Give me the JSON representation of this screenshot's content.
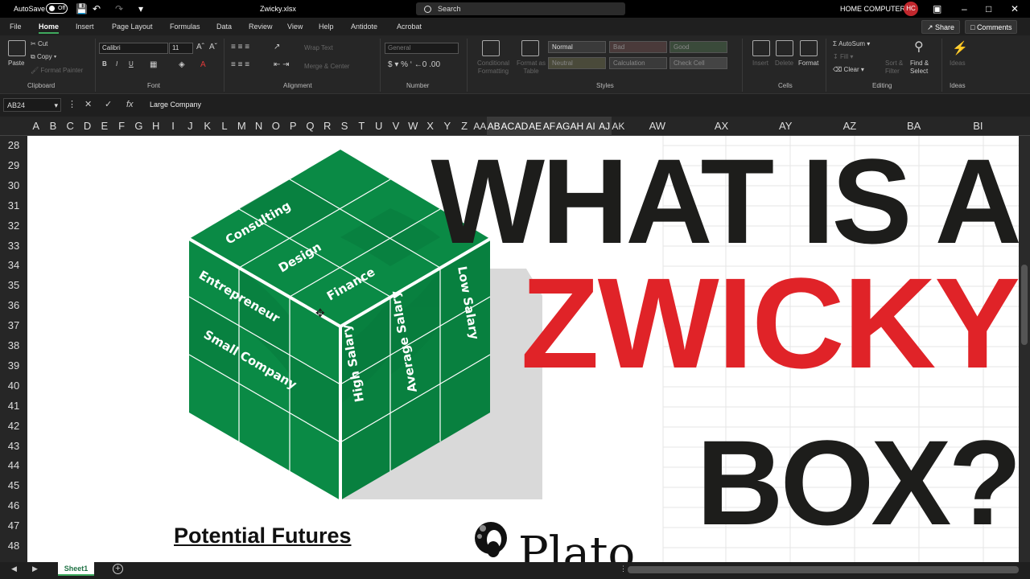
{
  "titlebar": {
    "autosave_label": "AutoSave",
    "autosave_state": "Off",
    "filename": "Zwicky.xlsx",
    "search_placeholder": "Search",
    "user_name": "HOME COMPUTER",
    "user_initials": "HC"
  },
  "menu": {
    "tabs": [
      "File",
      "Home",
      "Insert",
      "Page Layout",
      "Formulas",
      "Data",
      "Review",
      "View",
      "Help",
      "Antidote",
      "Acrobat"
    ],
    "active_tab": "Home",
    "share": "Share",
    "comments": "Comments"
  },
  "ribbon": {
    "clipboard": {
      "paste": "Paste",
      "cut": "Cut",
      "copy": "Copy",
      "format_painter": "Format Painter",
      "label": "Clipboard"
    },
    "font": {
      "name": "Calibri",
      "size": "11",
      "bold": "B",
      "italic": "I",
      "underline": "U",
      "label": "Font"
    },
    "alignment": {
      "wrap_text": "Wrap Text",
      "merge": "Merge & Center",
      "label": "Alignment"
    },
    "number": {
      "format": "General",
      "label": "Number"
    },
    "styles": {
      "conditional": "Conditional Formatting",
      "format_as_table": "Format as Table",
      "cells": [
        "Normal",
        "Bad",
        "Good",
        "Neutral",
        "Calculation",
        "Check Cell"
      ],
      "label": "Styles"
    },
    "cells": {
      "insert": "Insert",
      "delete": "Delete",
      "format": "Format",
      "label": "Cells"
    },
    "editing": {
      "autosum": "AutoSum",
      "fill": "Fill",
      "clear": "Clear",
      "sort_filter": "Sort & Filter",
      "find_select": "Find & Select",
      "label": "Editing"
    },
    "ideas": {
      "ideas": "Ideas",
      "label": "Ideas"
    }
  },
  "formula_bar": {
    "name_box": "AB24",
    "formula": "Large Company"
  },
  "columns": [
    "A",
    "B",
    "C",
    "D",
    "E",
    "F",
    "G",
    "H",
    "I",
    "J",
    "K",
    "L",
    "M",
    "N",
    "O",
    "P",
    "Q",
    "R",
    "S",
    "T",
    "U",
    "V",
    "W",
    "X",
    "Y",
    "Z",
    "AA",
    "AB",
    "AC",
    "AD",
    "AE",
    "AF",
    "AG",
    "AH",
    "AI",
    "AJ",
    "AK",
    "AW",
    "AX",
    "AY",
    "AZ",
    "BA",
    "BI"
  ],
  "rows": [
    "28",
    "29",
    "30",
    "31",
    "32",
    "33",
    "34",
    "35",
    "36",
    "37",
    "38",
    "39",
    "40",
    "41",
    "42",
    "43",
    "44",
    "45",
    "46",
    "47",
    "48"
  ],
  "cube": {
    "top_labels": [
      "Consulting",
      "Design",
      "Finance"
    ],
    "left_labels": [
      "Entrepreneur",
      "Small Company"
    ],
    "right_labels": [
      "High Salary",
      "Average Salary",
      "Low Salary"
    ],
    "colors": {
      "face": "#0a8a45",
      "face_dark": "#08753a",
      "grid": "#ffffff",
      "shadow": "#d9d9d9"
    }
  },
  "headline": {
    "line1": "WHAT IS A",
    "line2": "ZWICKY",
    "line3": "BOX?",
    "color_dark": "#1d1d1b",
    "color_red": "#e02328"
  },
  "caption": "Potential Futures",
  "logo_text": "Plato",
  "sheet_tabs": [
    "Sheet1"
  ]
}
